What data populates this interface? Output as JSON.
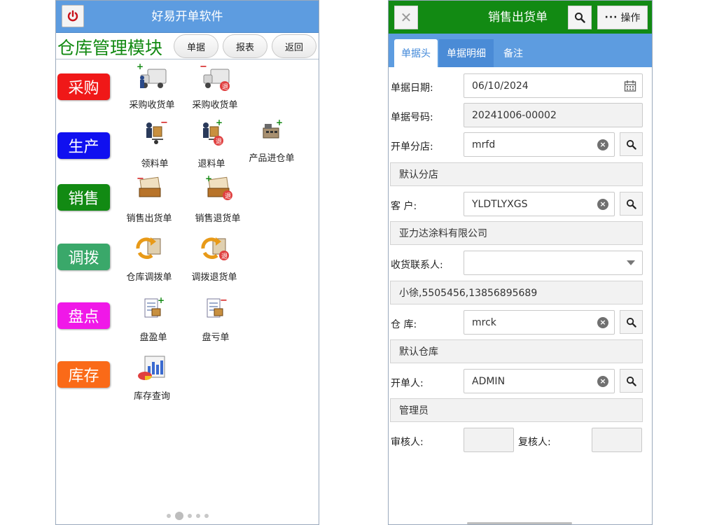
{
  "left": {
    "header_title": "好易开单软件",
    "module_title": "仓库管理模块",
    "top_buttons": [
      "单据",
      "报表",
      "返回"
    ],
    "categories": [
      {
        "label": "采购",
        "color": "#f01818"
      },
      {
        "label": "生产",
        "color": "#1010f0"
      },
      {
        "label": "销售",
        "color": "#128a13"
      },
      {
        "label": "调拨",
        "color": "#3aa86a"
      },
      {
        "label": "盘点",
        "color": "#f018e8"
      },
      {
        "label": "库存",
        "color": "#fa6a18"
      }
    ],
    "tiles": {
      "purchase_receive": "采购收货单",
      "purchase_return": "采购收货单",
      "material_pick": "领料单",
      "material_return": "退料单",
      "product_in": "产品进仓单",
      "sales_out": "销售出货单",
      "sales_return": "销售退货单",
      "transfer": "仓库调拨单",
      "transfer_return": "调拨退货单",
      "stock_gain": "盘盈单",
      "stock_loss": "盘亏单",
      "stock_query": "库存查询"
    }
  },
  "right": {
    "header_title": "销售出货单",
    "ops_label": "操作",
    "tabs": [
      "单据头",
      "单据明细",
      "备注"
    ],
    "form": {
      "date_label": "单据日期:",
      "date_value": "06/10/2024",
      "number_label": "单据号码:",
      "number_value": "20241006-00002",
      "branch_label": "开单分店:",
      "branch_value": "mrfd",
      "branch_name": "默认分店",
      "customer_label": "客 户:",
      "customer_value": "YLDTLYXGS",
      "customer_name": "亚力达涂料有限公司",
      "contact_label": "收货联系人:",
      "contact_value": "",
      "contact_info": "小徐,5505456,13856895689",
      "warehouse_label": "仓 库:",
      "warehouse_value": "mrck",
      "warehouse_name": "默认仓库",
      "creator_label": "开单人:",
      "creator_value": "ADMIN",
      "creator_name": "管理员",
      "reviewer_label": "审核人:",
      "rechecker_label": "复核人:"
    }
  }
}
